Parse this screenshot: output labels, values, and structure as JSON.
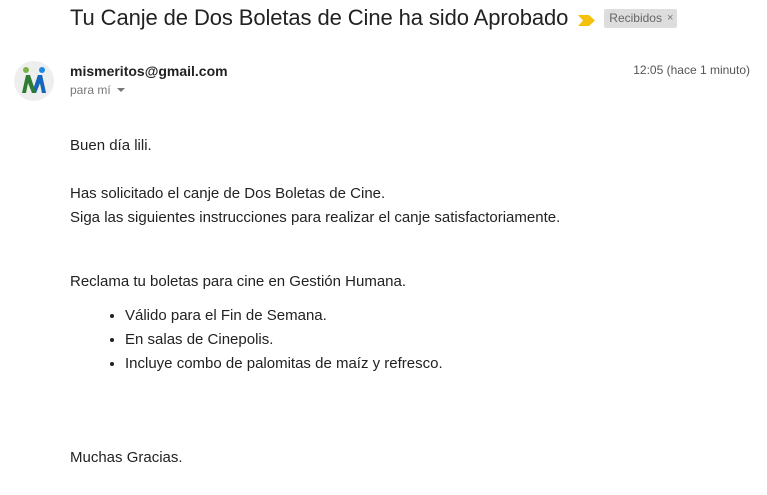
{
  "email": {
    "subject": "Tu Canje de Dos Boletas de Cine ha sido Aprobado",
    "label": "Recibidos",
    "label_close": "×",
    "importance_color": "#f4c20d",
    "sender": "mismeritos@gmail.com",
    "recipient": "para mí",
    "timestamp": "12:05 (hace 1 minuto)",
    "avatar_icon": "mismeritos-logo-icon"
  },
  "body": {
    "greeting": "Buen día lili.",
    "line1": "Has solicitado el canje de Dos Boletas de Cine.",
    "line2": "Siga las siguientes instrucciones para realizar el canje satisfactoriamente.",
    "line3": "Reclama tu boletas para cine en Gestión Humana.",
    "items": [
      "Válido para el Fin de Semana.",
      "En salas de Cinepolis.",
      "Incluye combo de palomitas de maíz y refresco."
    ],
    "closing": "Muchas Gracias."
  }
}
